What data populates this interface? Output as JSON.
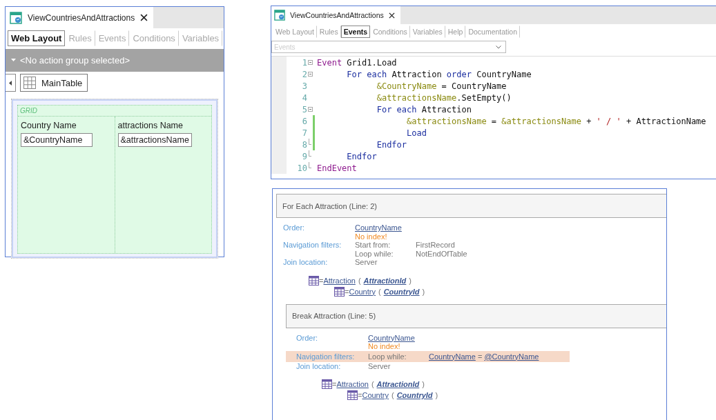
{
  "designer": {
    "title": "ViewCountriesAndAttractions",
    "tabs": [
      {
        "label": "Web Layout",
        "selected": true
      },
      {
        "label": "Rules",
        "selected": false
      },
      {
        "label": "Events",
        "selected": false
      },
      {
        "label": "Conditions",
        "selected": false
      },
      {
        "label": "Variables",
        "selected": false
      }
    ],
    "action_group": "<No action group selected>",
    "breadcrumb": "MainTable",
    "grid": {
      "label": "GRID",
      "columns": [
        {
          "header": "Country Name",
          "field": "&CountryName"
        },
        {
          "header": "attractions Name",
          "field": "&attractionsName"
        }
      ]
    }
  },
  "events_editor": {
    "title": "ViewCountriesAndAttractions",
    "tabs": [
      {
        "label": "Web Layout",
        "selected": false
      },
      {
        "label": "Rules",
        "selected": false
      },
      {
        "label": "Events",
        "selected": true
      },
      {
        "label": "Conditions",
        "selected": false
      },
      {
        "label": "Variables",
        "selected": false
      },
      {
        "label": "Help",
        "selected": false
      },
      {
        "label": "Documentation",
        "selected": false
      }
    ],
    "dropdown": {
      "placeholder": "Events"
    },
    "lines": [
      {
        "number": "1",
        "foldable": true,
        "fold_end": false,
        "changed": false,
        "tokens": [
          {
            "kind": "event",
            "text": "Event"
          },
          {
            "kind": "plain",
            "text": " Grid1.Load"
          }
        ]
      },
      {
        "number": "2",
        "foldable": true,
        "fold_end": false,
        "changed": false,
        "tokens": [
          {
            "kind": "keyword",
            "text": "      For each"
          },
          {
            "kind": "plain",
            "text": " Attraction "
          },
          {
            "kind": "keyword",
            "text": "order"
          },
          {
            "kind": "plain",
            "text": " CountryName"
          }
        ]
      },
      {
        "number": "3",
        "foldable": false,
        "fold_end": false,
        "changed": false,
        "tokens": [
          {
            "kind": "variable",
            "text": "            &CountryName"
          },
          {
            "kind": "plain",
            "text": " = CountryName"
          }
        ]
      },
      {
        "number": "4",
        "foldable": false,
        "fold_end": false,
        "changed": false,
        "tokens": [
          {
            "kind": "variable",
            "text": "            &attractionsName"
          },
          {
            "kind": "plain",
            "text": ".SetEmpty()"
          }
        ]
      },
      {
        "number": "5",
        "foldable": true,
        "fold_end": false,
        "changed": false,
        "tokens": [
          {
            "kind": "keyword",
            "text": "            For each"
          },
          {
            "kind": "plain",
            "text": " Attraction"
          }
        ]
      },
      {
        "number": "6",
        "foldable": false,
        "fold_end": false,
        "changed": true,
        "tokens": [
          {
            "kind": "variable",
            "text": "                  &attractionsName"
          },
          {
            "kind": "plain",
            "text": " = "
          },
          {
            "kind": "variable",
            "text": "&attractionsName"
          },
          {
            "kind": "plain",
            "text": " + "
          },
          {
            "kind": "string",
            "text": "' / '"
          },
          {
            "kind": "plain",
            "text": " + AttractionName"
          }
        ]
      },
      {
        "number": "7",
        "foldable": false,
        "fold_end": false,
        "changed": true,
        "tokens": [
          {
            "kind": "keyword",
            "text": "                  Load"
          }
        ]
      },
      {
        "number": "8",
        "foldable": false,
        "fold_end": true,
        "changed": true,
        "tokens": [
          {
            "kind": "keyword",
            "text": "            Endfor"
          }
        ]
      },
      {
        "number": "9",
        "foldable": false,
        "fold_end": true,
        "changed": false,
        "tokens": [
          {
            "kind": "keyword",
            "text": "      Endfor"
          }
        ]
      },
      {
        "number": "10",
        "foldable": false,
        "fold_end": true,
        "changed": false,
        "tokens": [
          {
            "kind": "event",
            "text": "EndEvent"
          }
        ]
      }
    ]
  },
  "navigation": {
    "sections": [
      {
        "title": "For Each Attraction (Line: 2)",
        "rows": [
          {
            "label": "Order:",
            "highlighted": false,
            "values": [
              {
                "kind": "link",
                "text": "CountryName"
              }
            ]
          },
          {
            "highlighted": false,
            "values": [
              {
                "kind": "warning",
                "text": "No index!"
              }
            ]
          },
          {
            "label": "Navigation filters:",
            "highlighted": false,
            "values": [
              {
                "kind": "text",
                "text": "Start from:"
              },
              {
                "kind": "text",
                "text": "FirstRecord"
              }
            ]
          },
          {
            "highlighted": false,
            "values": [
              {
                "kind": "text",
                "text": "Loop while:"
              },
              {
                "kind": "text",
                "text": "NotEndOfTable"
              }
            ]
          },
          {
            "label": "Join location:",
            "highlighted": false,
            "values": [
              {
                "kind": "text",
                "text": "Server"
              }
            ]
          }
        ],
        "tables": [
          {
            "equals": "=",
            "name": "Attraction",
            "open": "(",
            "key": "AttractionId",
            "close": ")",
            "children": [
              {
                "equals": "=",
                "name": "Country",
                "open": "(",
                "key": "CountryId",
                "close": ")"
              }
            ]
          }
        ]
      },
      {
        "title": "Break Attraction (Line: 5)",
        "rows": [
          {
            "label": "Order:",
            "highlighted": false,
            "values": [
              {
                "kind": "link",
                "text": "CountryName"
              }
            ]
          },
          {
            "highlighted": false,
            "values": [
              {
                "kind": "warning",
                "text": "No index!"
              }
            ]
          },
          {
            "label": "Navigation filters:",
            "highlighted": true,
            "values": [
              {
                "kind": "text",
                "text": "Loop while:"
              },
              {
                "kind": "condition",
                "left": "CountryName",
                "op": "=",
                "right": "@CountryName"
              }
            ]
          },
          {
            "label": "Join location:",
            "highlighted": false,
            "values": [
              {
                "kind": "text",
                "text": "Server"
              }
            ]
          }
        ],
        "tables": [
          {
            "equals": "=",
            "name": "Attraction",
            "open": "(",
            "key": "AttractionId",
            "close": ")",
            "children": [
              {
                "equals": "=",
                "name": "Country",
                "open": "(",
                "key": "CountryId",
                "close": ")"
              }
            ]
          }
        ]
      }
    ]
  }
}
